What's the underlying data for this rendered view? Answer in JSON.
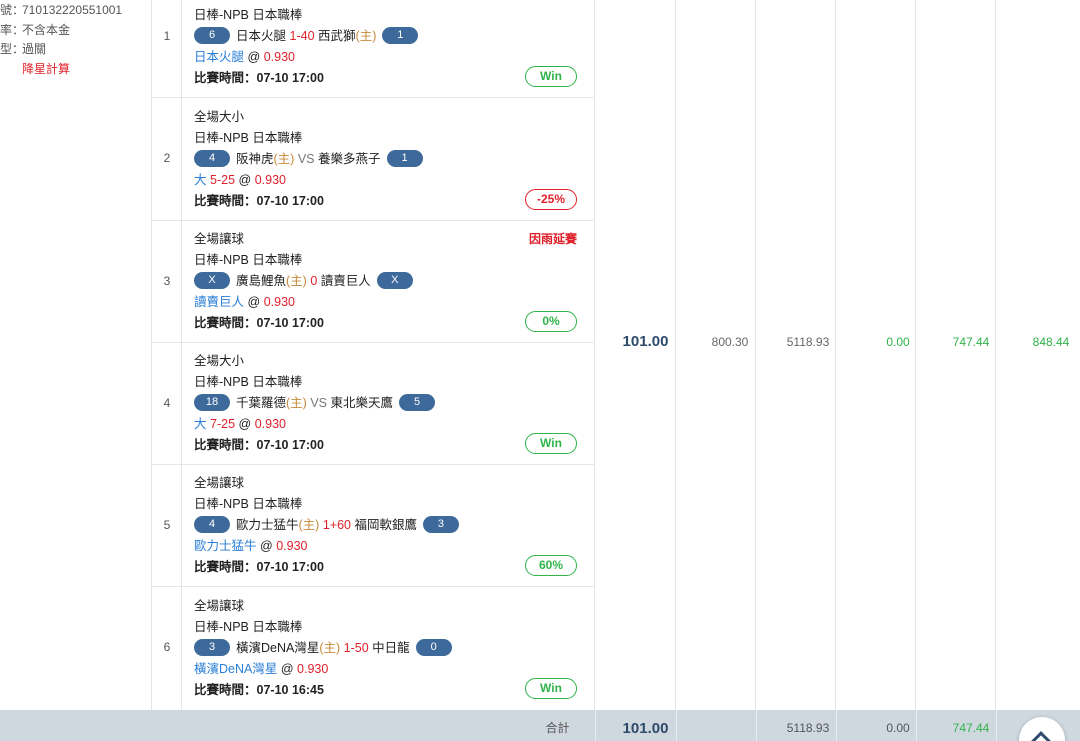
{
  "left_info": {
    "line1_key": "號：",
    "line1_val": "710132220551001",
    "line2_key": "率：",
    "line2_val": "不含本金",
    "line3_key": "型：",
    "line3_val": "過關",
    "line4": "降星計算"
  },
  "bets": [
    {
      "index": "1",
      "type": "",
      "league": "日棒-NPB 日本職棒",
      "left_score": "6",
      "home": "日本火腿",
      "home_mark": "(主)",
      "handicap": "1-40",
      "away": "西武獅",
      "away_mark": "(主)",
      "right_score": "1",
      "pick": "日本火腿",
      "at": "@",
      "odds": "0.930",
      "time_label": "比賽時間：",
      "time": "07-10 17:00",
      "result": "Win",
      "status": ""
    },
    {
      "index": "2",
      "type": "全場大小",
      "league": "日棒-NPB 日本職棒",
      "left_score": "4",
      "home": "阪神虎",
      "home_mark": "(主)",
      "vs": "VS",
      "away": "養樂多燕子",
      "right_score": "1",
      "pick": "大",
      "handicap": "5-25",
      "at": "@",
      "odds": "0.930",
      "time_label": "比賽時間：",
      "time": "07-10 17:00",
      "result": "-25%",
      "status": ""
    },
    {
      "index": "3",
      "type": "全場讓球",
      "league": "日棒-NPB 日本職棒",
      "left_score": "X",
      "home": "廣島鯉魚",
      "home_mark": "(主)",
      "handicap": "0",
      "away": "讀賣巨人",
      "right_score": "X",
      "pick": "讀賣巨人",
      "at": "@",
      "odds": "0.930",
      "time_label": "比賽時間：",
      "time": "07-10 17:00",
      "result": "0%",
      "status": "因雨延賽"
    },
    {
      "index": "4",
      "type": "全場大小",
      "league": "日棒-NPB 日本職棒",
      "left_score": "18",
      "home": "千葉羅德",
      "home_mark": "(主)",
      "vs": "VS",
      "away": "東北樂天鷹",
      "right_score": "5",
      "pick": "大",
      "handicap": "7-25",
      "at": "@",
      "odds": "0.930",
      "time_label": "比賽時間：",
      "time": "07-10 17:00",
      "result": "Win",
      "status": ""
    },
    {
      "index": "5",
      "type": "全場讓球",
      "league": "日棒-NPB 日本職棒",
      "left_score": "4",
      "home": "歐力士猛牛",
      "home_mark": "(主)",
      "handicap": "1+60",
      "away": "福岡軟銀鷹",
      "right_score": "3",
      "pick": "歐力士猛牛",
      "at": "@",
      "odds": "0.930",
      "time_label": "比賽時間：",
      "time": "07-10 17:00",
      "result": "60%",
      "status": ""
    },
    {
      "index": "6",
      "type": "全場讓球",
      "league": "日棒-NPB 日本職棒",
      "left_score": "3",
      "home": "橫濱DeNA灣星",
      "home_mark": "(主)",
      "handicap": "1-50",
      "away": "中日龍",
      "right_score": "0",
      "pick": "橫濱DeNA灣星",
      "at": "@",
      "odds": "0.930",
      "time_label": "比賽時間：",
      "time": "07-10 16:45",
      "result": "Win",
      "status": ""
    }
  ],
  "summary": {
    "stake": "101.00",
    "col2": "800.30",
    "col3": "5118.93",
    "col4": "0.00",
    "col5": "747.44",
    "col6": "848.44"
  },
  "footer": {
    "label": "合計",
    "stake": "101.00",
    "col3": "5118.93",
    "col4": "0.00",
    "col5": "747.44"
  },
  "colors": {
    "pill": "#3d6a9a",
    "win": "#2fb34a",
    "loss": "#e0212b",
    "home": "#c8893a",
    "pick": "#2a7ed6",
    "footer_bg": "#cfd8df"
  },
  "icons": {
    "scroll_top": "chevron-up-icon"
  }
}
